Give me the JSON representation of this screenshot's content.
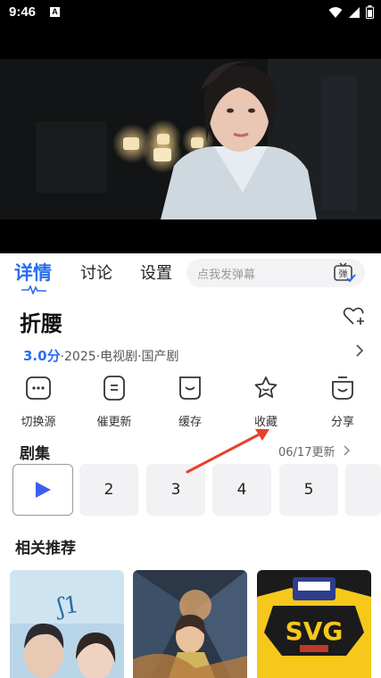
{
  "status_bar": {
    "time": "9:46",
    "notification_badge": "A"
  },
  "tabs": [
    {
      "label": "详情",
      "active": true
    },
    {
      "label": "讨论",
      "active": false
    },
    {
      "label": "设置",
      "active": false
    }
  ],
  "danmu": {
    "placeholder": "点我发弹幕",
    "toggle_label": "弹"
  },
  "show": {
    "title": "折腰",
    "score": "3.0分",
    "info": "·2025·电视剧·国产剧"
  },
  "actions": [
    {
      "label": "切换源",
      "icon": "switch-source-icon"
    },
    {
      "label": "催更新",
      "icon": "urge-update-icon"
    },
    {
      "label": "缓存",
      "icon": "cache-icon"
    },
    {
      "label": "收藏",
      "icon": "star-icon"
    },
    {
      "label": "分享",
      "icon": "share-icon"
    }
  ],
  "episodes": {
    "heading": "剧集",
    "update": "06/17更新",
    "items": [
      "2",
      "3",
      "4",
      "5"
    ]
  },
  "related": {
    "heading": "相关推荐"
  },
  "colors": {
    "accent": "#2b6df0",
    "arrow": "#e8412d"
  }
}
